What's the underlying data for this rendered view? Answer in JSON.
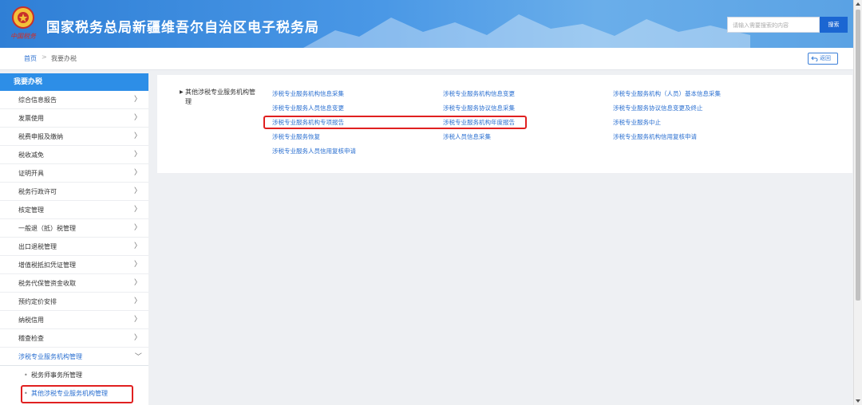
{
  "header": {
    "title": "国家税务总局新疆维吾尔自治区电子税务局",
    "logo_text": "中国税务",
    "search_placeholder": "请输入需要搜索的内容",
    "search_button": "搜索"
  },
  "breadcrumb": {
    "home": "首页",
    "separator": ">",
    "current": "我要办税",
    "back_label": "返回"
  },
  "sidebar": {
    "title": "我要办税",
    "items": [
      {
        "label": "综合信息报告"
      },
      {
        "label": "发票使用"
      },
      {
        "label": "税费申报及缴纳"
      },
      {
        "label": "税收减免"
      },
      {
        "label": "证明开具"
      },
      {
        "label": "税务行政许可"
      },
      {
        "label": "核定管理"
      },
      {
        "label": "一般退（抵）税管理"
      },
      {
        "label": "出口退税管理"
      },
      {
        "label": "增值税抵扣凭证管理"
      },
      {
        "label": "税务代保管资金收取"
      },
      {
        "label": "预约定价安排"
      },
      {
        "label": "纳税信用"
      },
      {
        "label": "稽查检查"
      }
    ],
    "open_item": "涉税专业服务机构管理",
    "sub_items": [
      {
        "label": "税务师事务所管理"
      },
      {
        "label": "其他涉税专业服务机构管理"
      }
    ]
  },
  "content": {
    "category": "其他涉税专业服务机构管理",
    "links": [
      [
        "涉税专业服务机构信息采集",
        "涉税专业服务机构信息变更",
        "涉税专业服务机构（人员）基本信息采集"
      ],
      [
        "涉税专业服务人员信息变更",
        "涉税专业服务协议信息采集",
        "涉税专业服务协议信息变更及终止"
      ],
      [
        "涉税专业服务机构专项报告",
        "涉税专业服务机构年度报告",
        "涉税专业服务中止"
      ],
      [
        "涉税专业服务恢复",
        "涉税人员信息采集",
        "涉税专业服务机构信用复核申请"
      ],
      [
        "涉税专业服务人员信用复核申请"
      ]
    ]
  },
  "colors": {
    "header_blue": "#2f7fd6",
    "link_blue": "#2a6fd0",
    "sidebar_head": "#2d8ee7",
    "highlight_red": "#e02020"
  }
}
